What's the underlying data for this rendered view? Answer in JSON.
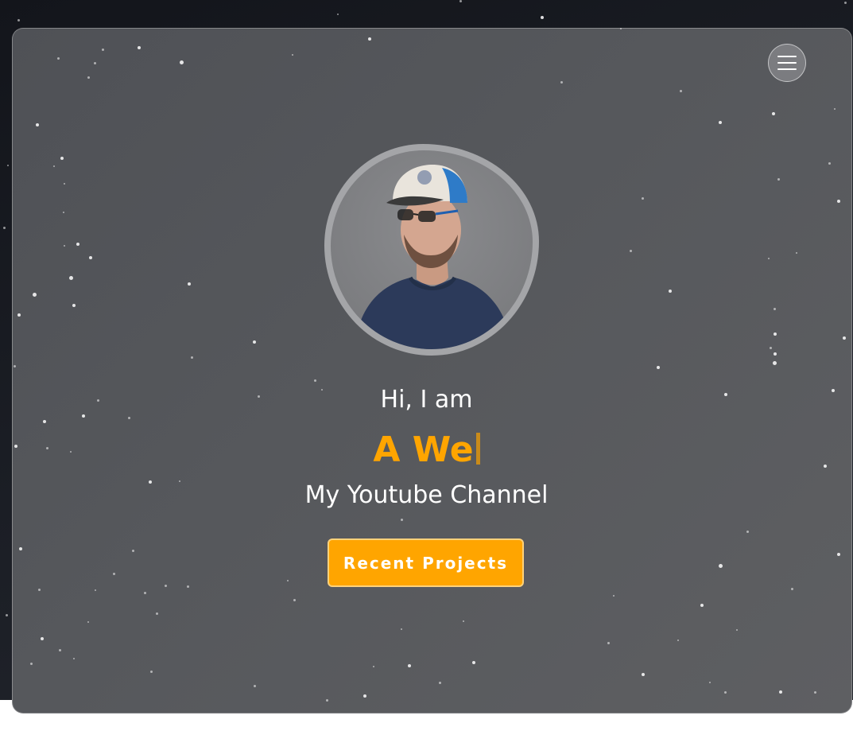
{
  "header": {
    "menu_icon": "hamburger-menu-icon"
  },
  "hero": {
    "greeting": "Hi, I am",
    "typed_text": "A We",
    "subtitle": "My Youtube Channel",
    "cta_label": "Recent Projects"
  },
  "colors": {
    "accent": "#ffa500",
    "text": "#ffffff",
    "card_background": "#56585c",
    "page_background": "#1b1e25"
  },
  "avatar": {
    "icon": "profile-photo"
  }
}
